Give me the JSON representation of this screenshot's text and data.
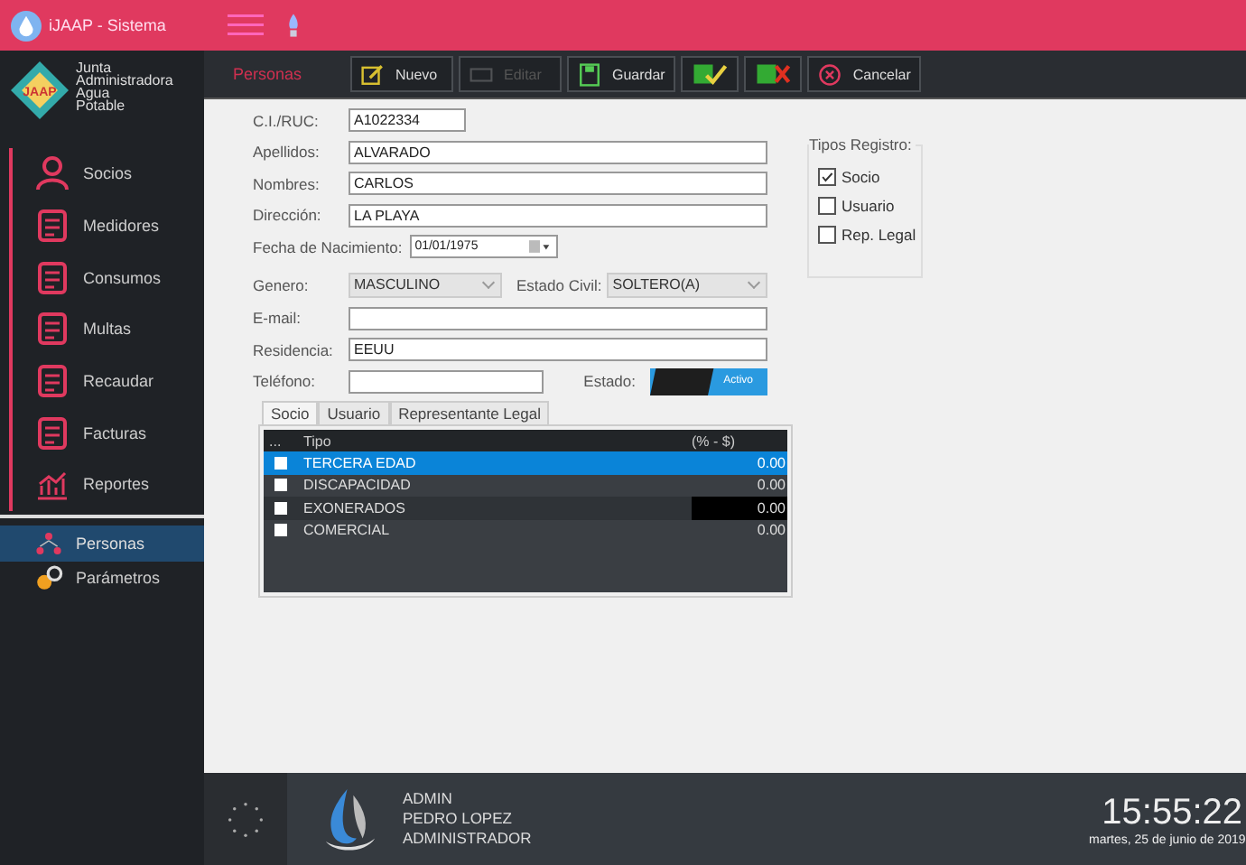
{
  "title_bar": {
    "title": "iJAAP - Sistema"
  },
  "sidebar": {
    "logo_lines": [
      "Junta",
      "Administradora",
      "Agua",
      "Potable"
    ],
    "logo_mark": "JAAP",
    "items": [
      {
        "label": "Socios",
        "selected": false
      },
      {
        "label": "Medidores",
        "selected": false
      },
      {
        "label": "Consumos",
        "selected": false
      },
      {
        "label": "Multas",
        "selected": false
      },
      {
        "label": "Recaudar",
        "selected": false
      },
      {
        "label": "Facturas",
        "selected": false
      },
      {
        "label": "Reportes",
        "selected": false
      },
      {
        "label": "Personas",
        "selected": true
      },
      {
        "label": "Parámetros",
        "selected": false
      }
    ]
  },
  "toolbar": {
    "section_title": "Personas",
    "buttons": [
      {
        "kind": "new",
        "label": "Nuevo",
        "disabled": false
      },
      {
        "kind": "edit",
        "label": "Editar",
        "disabled": true
      },
      {
        "kind": "save",
        "label": "Guardar",
        "disabled": false
      },
      {
        "kind": "approve",
        "disabled": false
      },
      {
        "kind": "reject",
        "disabled": false
      },
      {
        "kind": "cancel",
        "label": "Cancelar",
        "disabled": false
      }
    ]
  },
  "form": {
    "ci": {
      "label": "C.I./RUC:",
      "value": "A1022334"
    },
    "apellidos": {
      "label": "Apellidos:",
      "value": "ALVARADO"
    },
    "nombres": {
      "label": "Nombres:",
      "value": "CARLOS"
    },
    "direccion": {
      "label": "Dirección:",
      "value": "LA PLAYA"
    },
    "fecha": {
      "label": "Fecha de Nacimiento:",
      "value": "01/01/1975"
    },
    "genero": {
      "label": "Genero:",
      "value": "MASCULINO"
    },
    "estado_civil": {
      "label": "Estado Civil:",
      "value": "SOLTERO(A)"
    },
    "email": {
      "label": "E-mail:"
    },
    "residencia": {
      "label": "Residencia:",
      "value": "EEUU"
    },
    "telefono": {
      "label": "Teléfono:"
    },
    "estado": {
      "label": "Estado:",
      "toggle_label": "Activo",
      "on": true
    }
  },
  "tipos_registro": {
    "title": "Tipos Registro:",
    "options": [
      {
        "label": "Socio",
        "checked": true
      },
      {
        "label": "Usuario",
        "checked": false
      },
      {
        "label": "Rep. Legal",
        "checked": false
      }
    ]
  },
  "tabs": [
    {
      "label": "Socio",
      "selected": true
    },
    {
      "label": "Usuario",
      "selected": false
    },
    {
      "label": "Representante Legal",
      "selected": false
    }
  ],
  "table": {
    "columns": [
      "...",
      "Tipo",
      "(% - $)"
    ],
    "rows": [
      {
        "tipo": "TERCERA EDAD",
        "value": "0.00",
        "checked": false,
        "selected": true,
        "editing": false
      },
      {
        "tipo": "DISCAPACIDAD",
        "value": "0.00",
        "checked": false,
        "selected": false,
        "editing": false
      },
      {
        "tipo": "EXONERADOS",
        "value": "0.00",
        "checked": false,
        "selected": false,
        "editing": true
      },
      {
        "tipo": "COMERCIAL",
        "value": "0.00",
        "checked": false,
        "selected": false,
        "editing": false
      }
    ]
  },
  "footer": {
    "user_lines": [
      "ADMIN",
      "PEDRO LOPEZ",
      "ADMINISTRADOR"
    ],
    "time": "15:55:22",
    "date": "martes, 25 de junio de 2019"
  }
}
